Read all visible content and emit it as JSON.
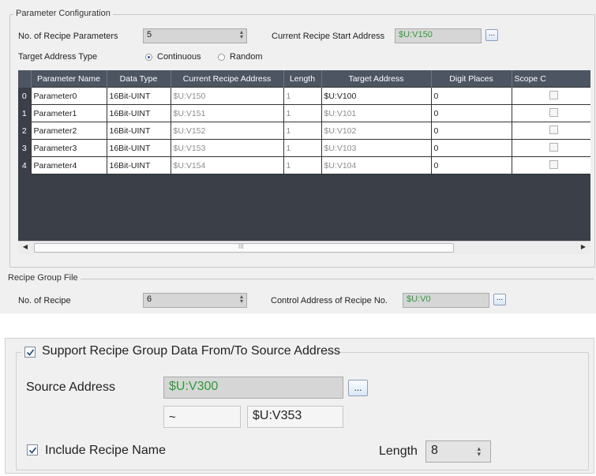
{
  "param_config": {
    "legend": "Parameter Configuration",
    "num_params_label": "No. of Recipe Parameters",
    "num_params_value": "5",
    "start_addr_label": "Current Recipe Start Address",
    "start_addr_value": "$U:V150",
    "browse_label": "...",
    "target_type_label": "Target Address Type",
    "opt_continuous": "Continuous",
    "opt_random": "Random",
    "selected_option": "Continuous",
    "columns": [
      "Parameter Name",
      "Data Type",
      "Current Recipe Address",
      "Length",
      "Target Address",
      "Digit Places",
      "Scope C"
    ],
    "rows": [
      {
        "idx": "0",
        "name": "Parameter0",
        "type": "16Bit-UINT",
        "cur": "$U:V150",
        "len": "1",
        "target": "$U:V100",
        "digits": "0"
      },
      {
        "idx": "1",
        "name": "Parameter1",
        "type": "16Bit-UINT",
        "cur": "$U:V151",
        "len": "1",
        "target": "$U:V101",
        "digits": "0"
      },
      {
        "idx": "2",
        "name": "Parameter2",
        "type": "16Bit-UINT",
        "cur": "$U:V152",
        "len": "1",
        "target": "$U:V102",
        "digits": "0"
      },
      {
        "idx": "3",
        "name": "Parameter3",
        "type": "16Bit-UINT",
        "cur": "$U:V153",
        "len": "1",
        "target": "$U:V103",
        "digits": "0"
      },
      {
        "idx": "4",
        "name": "Parameter4",
        "type": "16Bit-UINT",
        "cur": "$U:V154",
        "len": "1",
        "target": "$U:V104",
        "digits": "0"
      }
    ],
    "hscroll_thumb_mark": "III"
  },
  "group_file": {
    "legend": "Recipe Group File",
    "num_recipe_label": "No. of Recipe",
    "num_recipe_value": "6",
    "ctrl_addr_label": "Control Address of Recipe No.",
    "ctrl_addr_value": "$U:V0",
    "browse_label": "..."
  },
  "support": {
    "checkbox_label": "Support Recipe Group Data From/To Source Address",
    "checked": true,
    "source_label": "Source Address",
    "source_value": "$U:V300",
    "browse_label": "...",
    "range_sep": "~",
    "range_end": "$U:V353",
    "include_name_label": "Include Recipe Name",
    "include_name_checked": true,
    "length_label": "Length",
    "length_value": "8"
  },
  "colors": {
    "grid_header": "#4d5563",
    "address_green": "#2f9a3a",
    "panel_bg": "#f0f0f0"
  }
}
